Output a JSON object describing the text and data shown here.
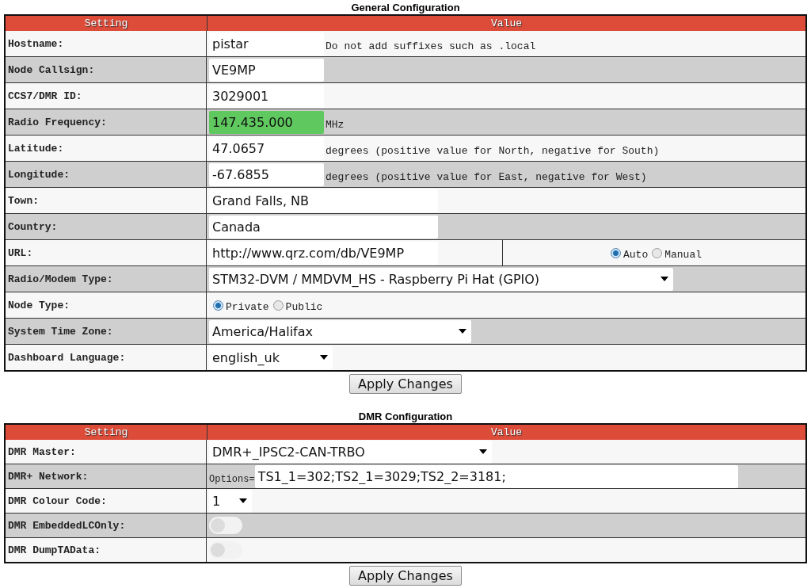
{
  "sections": [
    {
      "title": "General Configuration",
      "columns": [
        "Setting",
        "Value"
      ],
      "rows": [
        {
          "kind": "text",
          "label": "Hostname:",
          "value": "pistar",
          "highlighted": false,
          "note": "Do not add suffixes such as .local"
        },
        {
          "kind": "text",
          "label": "Node Callsign:",
          "value": "VE9MP",
          "highlighted": false
        },
        {
          "kind": "text",
          "label": "CCS7/DMR ID:",
          "value": "3029001",
          "highlighted": false
        },
        {
          "kind": "text",
          "label": "Radio Frequency:",
          "value": "147.435.000",
          "highlighted": true,
          "note": "MHz"
        },
        {
          "kind": "text",
          "label": "Latitude:",
          "value": "47.0657",
          "highlighted": false,
          "note": "degrees (positive value for North, negative for South)"
        },
        {
          "kind": "text",
          "label": "Longitude:",
          "value": "-67.6855",
          "highlighted": false,
          "note": "degrees (positive value for East, negative for West)"
        },
        {
          "kind": "text",
          "label": "Town:",
          "value": "Grand Falls, NB",
          "highlighted": false
        },
        {
          "kind": "text",
          "label": "Country:",
          "value": "Canada",
          "highlighted": false
        },
        {
          "kind": "text-radio",
          "label": "URL:",
          "value": "http://www.qrz.com/db/VE9MP",
          "highlighted": false,
          "options": [
            {
              "label": "Auto",
              "selected": true
            },
            {
              "label": "Manual",
              "selected": false
            }
          ]
        },
        {
          "kind": "select",
          "label": "Radio/Modem Type:",
          "value": "STM32-DVM / MMDVM_HS - Raspberry Pi Hat (GPIO)"
        },
        {
          "kind": "radio",
          "label": "Node Type:",
          "options": [
            {
              "label": "Private",
              "selected": true
            },
            {
              "label": "Public",
              "selected": false
            }
          ]
        },
        {
          "kind": "select",
          "label": "System Time Zone:",
          "value": "America/Halifax"
        },
        {
          "kind": "select",
          "label": "Dashboard Language:",
          "value": "english_uk"
        }
      ],
      "button": "Apply Changes"
    },
    {
      "title": "DMR Configuration",
      "columns": [
        "Setting",
        "Value"
      ],
      "rows": [
        {
          "kind": "select",
          "label": "DMR Master:",
          "value": "DMR+_IPSC2-CAN-TRBO"
        },
        {
          "kind": "prefixed",
          "label": "DMR+ Network:",
          "prefix": "Options=",
          "value": "TS1_1=302;TS2_1=3029;TS2_2=3181;"
        },
        {
          "kind": "select",
          "label": "DMR Colour Code:",
          "value": "1"
        },
        {
          "kind": "toggle",
          "label": "DMR EmbeddedLCOnly:",
          "on": false
        },
        {
          "kind": "toggle",
          "label": "DMR DumpTAData:",
          "on": false
        }
      ],
      "button": "Apply Changes"
    }
  ]
}
